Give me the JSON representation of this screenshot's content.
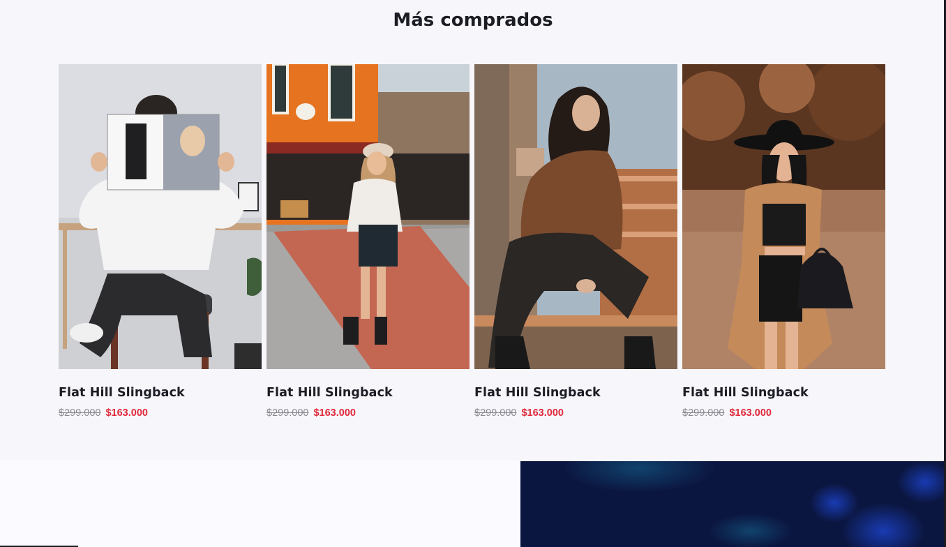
{
  "section": {
    "title": "Más comprados"
  },
  "products": [
    {
      "name": "Flat Hill Slingback",
      "old_price": "$299.000",
      "new_price": "$163.000",
      "image_icon": "woman-reading-magazine-photo"
    },
    {
      "name": "Flat Hill Slingback",
      "old_price": "$299.000",
      "new_price": "$163.000",
      "image_icon": "woman-on-street-photo"
    },
    {
      "name": "Flat Hill Slingback",
      "old_price": "$299.000",
      "new_price": "$163.000",
      "image_icon": "woman-brown-sweater-photo"
    },
    {
      "name": "Flat Hill Slingback",
      "old_price": "$299.000",
      "new_price": "$163.000",
      "image_icon": "woman-black-hat-photo"
    }
  ],
  "colors": {
    "price_sale": "#e0283a",
    "price_old": "#8a8a92",
    "title": "#1c1c24",
    "promo_bg": "#0b1640"
  }
}
